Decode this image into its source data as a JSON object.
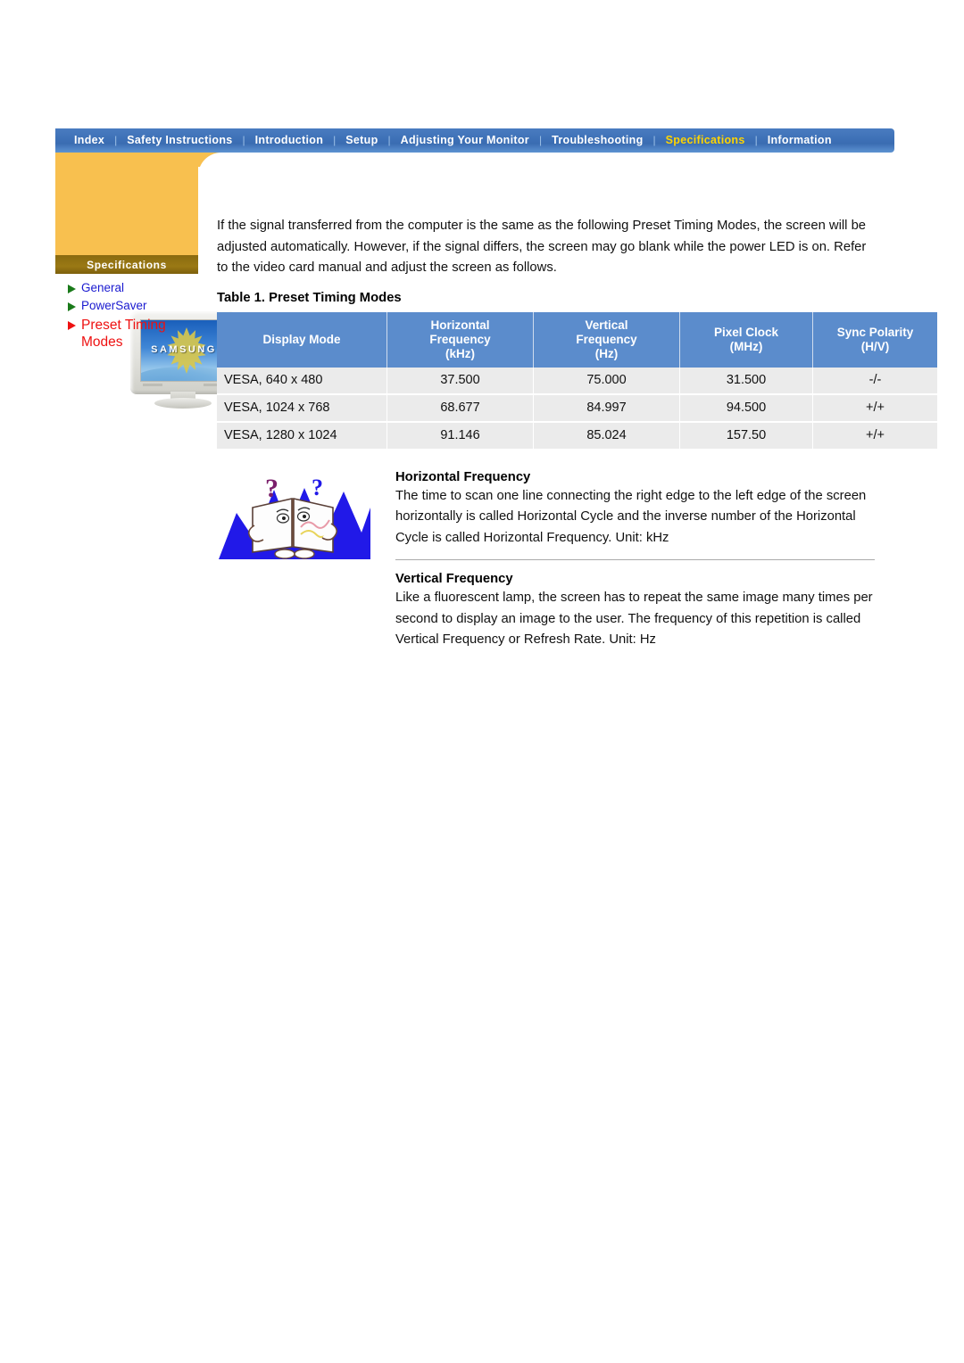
{
  "nav": {
    "items": [
      {
        "label": "Index",
        "active": false
      },
      {
        "label": "Safety Instructions",
        "active": false
      },
      {
        "label": "Introduction",
        "active": false
      },
      {
        "label": "Setup",
        "active": false
      },
      {
        "label": "Adjusting Your Monitor",
        "active": false
      },
      {
        "label": "Troubleshooting",
        "active": false
      },
      {
        "label": "Specifications",
        "active": true
      },
      {
        "label": "Information",
        "active": false
      }
    ],
    "separator": "|",
    "bar_color": "#3f72b8",
    "active_color": "#ffd400"
  },
  "sidebar": {
    "caption": "Specifications",
    "monitor_brand": "SAMSUNG",
    "block_color": "#f8c04f",
    "caption_band_color": "#8a6a10",
    "links": [
      {
        "label": "General",
        "current": false,
        "color": "#1a1ad0",
        "marker": "green-triangle-icon"
      },
      {
        "label": "PowerSaver",
        "current": false,
        "color": "#1a1ad0",
        "marker": "green-triangle-icon"
      },
      {
        "label": "Preset Timing Modes",
        "current": true,
        "color": "#ee1111",
        "marker": "red-triangle-icon"
      }
    ]
  },
  "main": {
    "intro": "If the signal transferred from the computer is the same as the following Preset Timing Modes, the screen will be adjusted automatically. However, if the signal differs, the screen may go blank while the power LED is on. Refer to the video card manual and adjust the screen as follows.",
    "table_title": "Table 1. Preset Timing Modes",
    "table": {
      "header_color": "#5b8ccc",
      "row_color": "#ebebeb",
      "columns": [
        {
          "line1": "Display Mode",
          "line2": "",
          "line3": ""
        },
        {
          "line1": "Horizontal",
          "line2": "Frequency",
          "line3": "(kHz)"
        },
        {
          "line1": "Vertical",
          "line2": "Frequency",
          "line3": "(Hz)"
        },
        {
          "line1": "Pixel Clock",
          "line2": "(MHz)",
          "line3": ""
        },
        {
          "line1": "Sync Polarity",
          "line2": "(H/V)",
          "line3": ""
        }
      ],
      "rows": [
        {
          "mode": "VESA, 640 x 480",
          "h_freq": "37.500",
          "v_freq": "75.000",
          "pixel_clock": "31.500",
          "sync": "-/-"
        },
        {
          "mode": "VESA, 1024 x 768",
          "h_freq": "68.677",
          "v_freq": "84.997",
          "pixel_clock": "94.500",
          "sync": "+/+"
        },
        {
          "mode": "VESA, 1280 x 1024",
          "h_freq": "91.146",
          "v_freq": "85.024",
          "pixel_clock": "157.50",
          "sync": "+/+"
        }
      ]
    },
    "sections": [
      {
        "heading": "Horizontal Frequency",
        "body": "The time to scan one line connecting the right edge to the left edge of the screen horizontally is called Horizontal Cycle and the inverse number of the Horizontal Cycle is called Horizontal Frequency. Unit: kHz"
      },
      {
        "heading": "Vertical Frequency",
        "body": "Like a fluorescent lamp, the screen has to repeat the same image many times per second to display an image to the user. The frequency of this repetition is called Vertical Frequency or Refresh Rate. Unit: Hz"
      }
    ],
    "figure": {
      "name": "book-character-illustration",
      "marks": [
        "?",
        "?"
      ]
    }
  }
}
